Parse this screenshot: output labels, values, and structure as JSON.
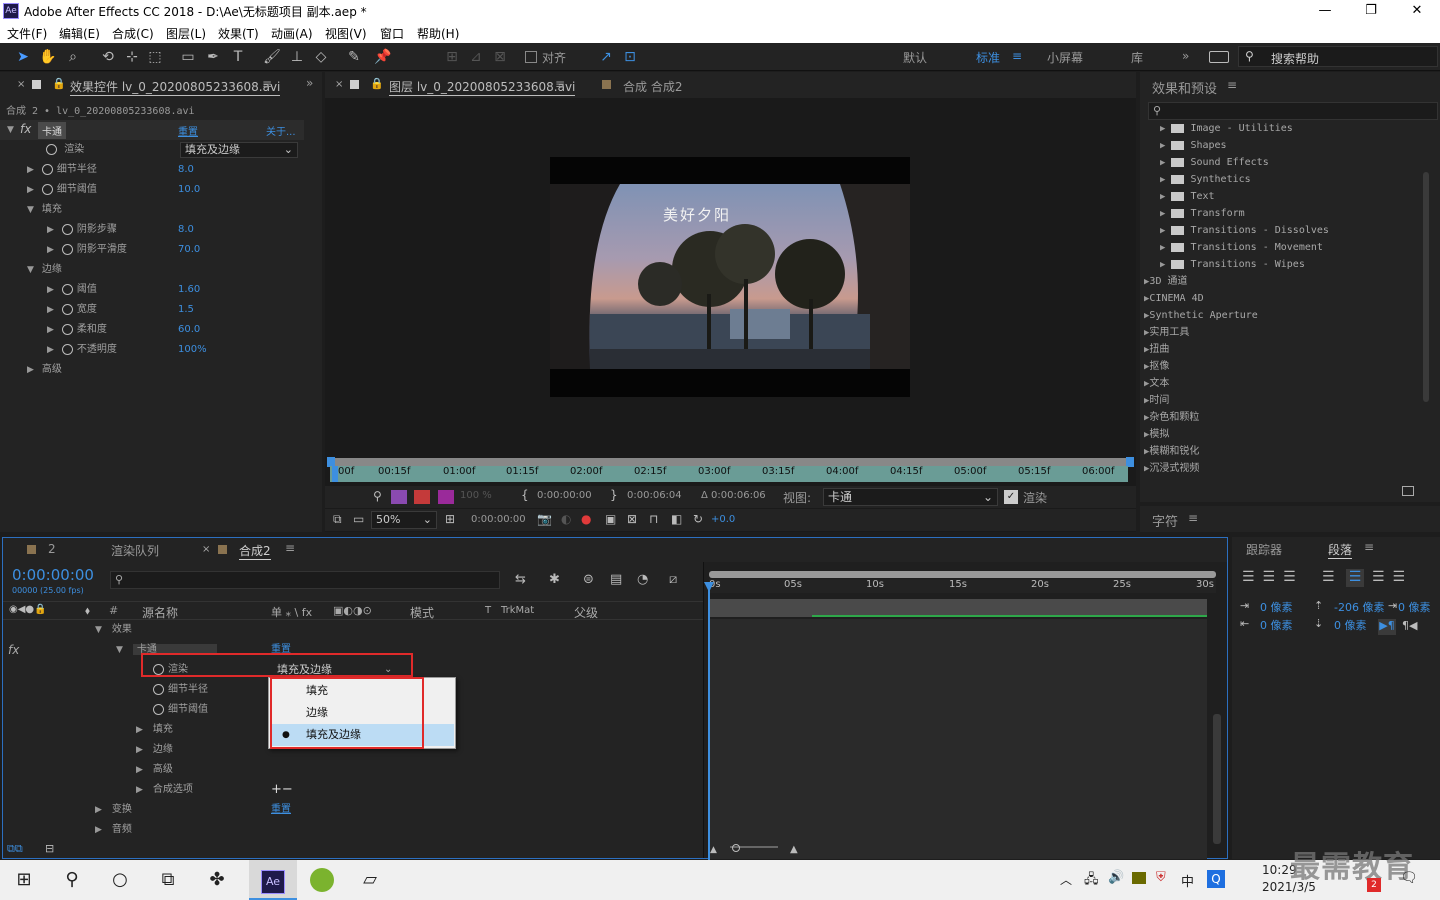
{
  "window": {
    "title": "Adobe After Effects CC 2018 - D:\\Ae\\无标题项目 副本.aep *",
    "app_icon": "Ae"
  },
  "menu": [
    "文件(F)",
    "编辑(E)",
    "合成(C)",
    "图层(L)",
    "效果(T)",
    "动画(A)",
    "视图(V)",
    "窗口",
    "帮助(H)"
  ],
  "toolbar": {
    "snap_label": "对齐",
    "workspaces": [
      "默认",
      "标准",
      "小屏幕",
      "库"
    ],
    "active_workspace": "标准",
    "search_placeholder": "搜索帮助"
  },
  "effect_controls": {
    "tab": "效果控件 lv_0_20200805233608.avi",
    "breadcrumb": "合成 2 • lv_0_20200805233608.avi",
    "effect_name": "卡通",
    "reset": "重置",
    "about": "关于...",
    "render_label": "渲染",
    "render_value": "填充及边缘",
    "params": [
      {
        "name": "细节半径",
        "value": "8.0"
      },
      {
        "name": "细节阈值",
        "value": "10.0"
      }
    ],
    "fill_group": "填充",
    "fill_params": [
      {
        "name": "阴影步骤",
        "value": "8.0"
      },
      {
        "name": "阴影平滑度",
        "value": "70.0"
      }
    ],
    "edge_group": "边缘",
    "edge_params": [
      {
        "name": "阈值",
        "value": "1.60"
      },
      {
        "name": "宽度",
        "value": "1.5"
      },
      {
        "name": "柔和度",
        "value": "60.0"
      },
      {
        "name": "不透明度",
        "value": "100%"
      }
    ],
    "advanced": "高级"
  },
  "viewer": {
    "layer_tab": "图层 lv_0_20200805233608.avi",
    "comp_tab": "合成 合成2",
    "video_caption": "美好夕阳",
    "ruler": [
      "00f",
      "00:15f",
      "01:00f",
      "01:15f",
      "02:00f",
      "02:15f",
      "03:00f",
      "03:15f",
      "04:00f",
      "04:15f",
      "05:00f",
      "05:15f",
      "06:00f"
    ],
    "opacity": "100 %",
    "in_time": "0:00:00:00",
    "out_time": "0:00:06:04",
    "duration": "Δ 0:00:06:06",
    "view_label": "视图:",
    "view_value": "卡通",
    "render_toggle": "渲染",
    "zoom": "50%",
    "time": "0:00:00:00",
    "exposure": "+0.0"
  },
  "effects_presets": {
    "title": "效果和预设",
    "search_placeholder": "",
    "folders": [
      "Image - Utilities",
      "Shapes",
      "Sound Effects",
      "Synthetics",
      "Text",
      "Transform",
      "Transitions - Dissolves",
      "Transitions - Movement",
      "Transitions - Wipes"
    ],
    "categories": [
      "3D 通道",
      "CINEMA 4D",
      "Synthetic Aperture",
      "实用工具",
      "扭曲",
      "抠像",
      "文本",
      "时间",
      "杂色和颗粒",
      "模拟",
      "模糊和锐化",
      "沉浸式视频"
    ]
  },
  "character_panel": {
    "title": "字符"
  },
  "timeline": {
    "tabs": [
      "2",
      "渲染队列",
      "合成2"
    ],
    "timecode": "0:00:00:00",
    "fps": "00000 (25.00 fps)",
    "headers": {
      "source": "源名称",
      "switches": "单 ⁎ \\ fx",
      "mode": "模式",
      "t": "T",
      "trkmat": "TrkMat",
      "parent": "父级"
    },
    "rows": {
      "effects": "效果",
      "cartoon": "卡通",
      "reset": "重置",
      "render": "渲染",
      "render_value": "填充及边缘",
      "detail_radius": "细节半径",
      "detail_threshold": "细节阈值",
      "fill": "填充",
      "edge": "边缘",
      "advanced": "高级",
      "compositing": "合成选项",
      "transform": "变换",
      "transform_reset": "重置",
      "audio": "音频"
    },
    "ruler": [
      "0s",
      "05s",
      "10s",
      "15s",
      "20s",
      "25s",
      "30s"
    ],
    "dropdown": {
      "options": [
        "填充",
        "边缘",
        "填充及边缘"
      ],
      "selected": "填充及边缘"
    }
  },
  "paragraph_panel": {
    "tabs": [
      "跟踪器",
      "段落"
    ],
    "indent_left": "0 像素",
    "indent_right": "0 像素",
    "space_before": "-206 像素",
    "space_after": "0 像素",
    "first_line": "0 像素"
  },
  "taskbar": {
    "time": "10:29",
    "date": "2021/3/5",
    "ime": "中",
    "notify_count": "2",
    "watermark": "最需教育"
  },
  "colors": {
    "accent": "#3d8fe0",
    "highlight_box": "#e02a2a",
    "bg": "#232323"
  }
}
